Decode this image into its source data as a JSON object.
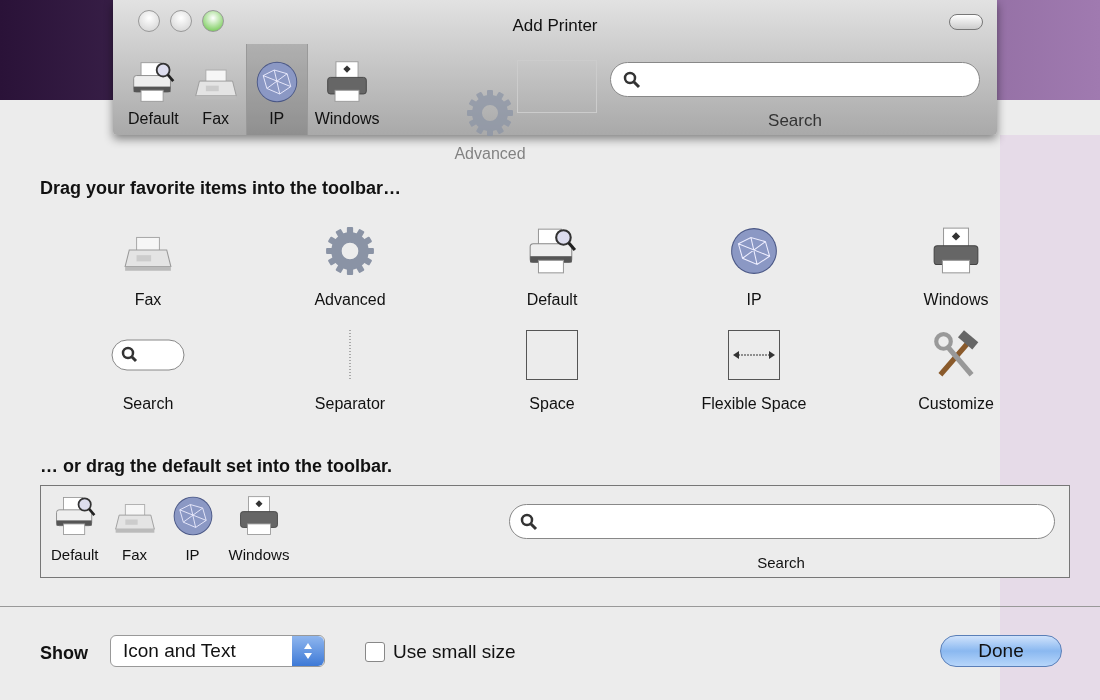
{
  "window": {
    "title": "Add Printer",
    "toolbar": [
      {
        "label": "Default",
        "kind": "printer-search",
        "selected": false
      },
      {
        "label": "Fax",
        "kind": "fax",
        "selected": false
      },
      {
        "label": "IP",
        "kind": "globe",
        "selected": true
      },
      {
        "label": "Windows",
        "kind": "printer-windows",
        "selected": false
      }
    ],
    "search_label": "Search"
  },
  "dragging_item": {
    "label": "Advanced",
    "kind": "gear"
  },
  "sheet": {
    "heading": "Drag your favorite items into the toolbar…",
    "items": [
      {
        "label": "Fax",
        "kind": "fax"
      },
      {
        "label": "Advanced",
        "kind": "gear"
      },
      {
        "label": "Default",
        "kind": "printer-search"
      },
      {
        "label": "IP",
        "kind": "globe"
      },
      {
        "label": "Windows",
        "kind": "printer-windows"
      },
      {
        "label": "Search",
        "kind": "search"
      },
      {
        "label": "Separator",
        "kind": "separator"
      },
      {
        "label": "Space",
        "kind": "space"
      },
      {
        "label": "Flexible Space",
        "kind": "flexible-space"
      },
      {
        "label": "Customize",
        "kind": "tools"
      }
    ],
    "default_heading": "… or drag the default set into the toolbar.",
    "default_set": [
      {
        "label": "Default",
        "kind": "printer-search"
      },
      {
        "label": "Fax",
        "kind": "fax"
      },
      {
        "label": "IP",
        "kind": "globe"
      },
      {
        "label": "Windows",
        "kind": "printer-windows"
      }
    ],
    "default_search_label": "Search",
    "show_label": "Show",
    "show_value": "Icon and Text",
    "small_size": {
      "label": "Use small size",
      "checked": false
    },
    "done": "Done"
  }
}
